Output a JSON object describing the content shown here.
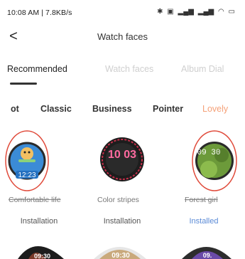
{
  "status_bar": {
    "time": "10:08 AM | 7.8KB/s",
    "icons": [
      "sync-icon",
      "mail-icon",
      "bluetooth-icon",
      "nfc-icon",
      "signal-icon",
      "signal-icon",
      "wifi-icon",
      "battery-icon"
    ]
  },
  "header": {
    "back_glyph": "<",
    "title": "Watch faces"
  },
  "top_tabs": [
    {
      "label": "Recommended",
      "active": true
    },
    {
      "label": "Watch faces",
      "active": false
    },
    {
      "label": "Album Dial",
      "active": false
    }
  ],
  "categories": [
    "ot",
    "Classic",
    "Business",
    "Pointer",
    "Lovely"
  ],
  "active_category": "Lovely",
  "faces": [
    {
      "name": "Comfortable life",
      "time_text": "12:23",
      "action": "Installation"
    },
    {
      "name": "Color stripes",
      "time_text": "10 03",
      "action": "Installation"
    },
    {
      "name": "Forest girl",
      "time_text": "09 30",
      "action": "Installed"
    }
  ],
  "bottom_faces": [
    {
      "time_text": "09:30"
    },
    {
      "time_text": "09:30"
    },
    {
      "time_text": "09."
    }
  ],
  "colors": {
    "accent": "#f5a178",
    "installed": "#5a8ad6",
    "selection_ring": "#e04a3a"
  }
}
